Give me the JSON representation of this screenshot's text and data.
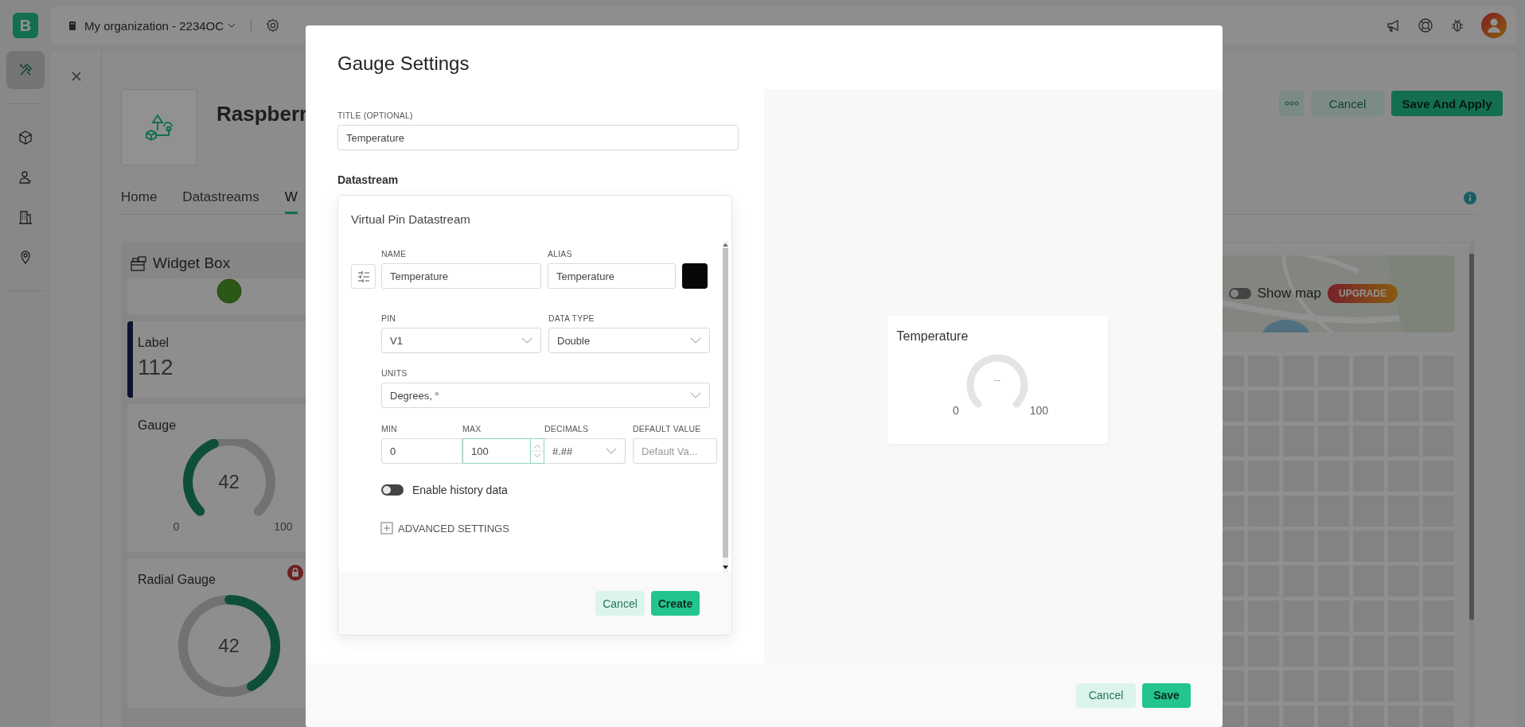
{
  "app": {
    "logo": "B",
    "sidebar": {
      "items": [
        {
          "selected": true
        },
        {
          "selected": false
        },
        {
          "selected": false
        },
        {
          "selected": false
        },
        {
          "selected": false
        }
      ]
    },
    "top_bar": {
      "organization": "My organization - 2234OC"
    },
    "template": {
      "title": "Raspberr",
      "tabs": [
        {
          "label": "Home",
          "selected": false
        },
        {
          "label": "Datastreams",
          "selected": false
        },
        {
          "label": "W",
          "selected": true
        }
      ]
    },
    "actions": {
      "cancel": "Cancel",
      "save": "Save And Apply"
    },
    "widget_box": {
      "title": "Widget Box",
      "widgets": [
        {
          "kind": "led"
        },
        {
          "kind": "label",
          "title": "Label",
          "value": "112"
        },
        {
          "kind": "gauge",
          "title": "Gauge",
          "value": "42",
          "min": "0",
          "max": "100"
        },
        {
          "kind": "radial",
          "title": "Radial Gauge",
          "value": "42"
        }
      ]
    },
    "map": {
      "kind": "picture",
      "toggle_label": "Show map",
      "on": false,
      "badge": "UPGRADE"
    }
  },
  "dialog": {
    "title": "Gauge Settings",
    "title_field": {
      "label": "TITLE (OPTIONAL)",
      "value": "Temperature"
    },
    "datastream": {
      "heading": "Datastream",
      "card_title": "Virtual Pin Datastream",
      "name": {
        "label": "NAME",
        "value": "Temperature"
      },
      "alias": {
        "label": "ALIAS",
        "value": "Temperature"
      },
      "color": "#070707",
      "pin": {
        "label": "PIN",
        "value": "V1"
      },
      "data_type": {
        "label": "DATA TYPE",
        "value": "Double"
      },
      "units": {
        "label": "UNITS",
        "value": "Degrees, °"
      },
      "min": {
        "label": "MIN",
        "value": "0"
      },
      "max": {
        "label": "MAX",
        "value": "100",
        "focused": true
      },
      "decimals": {
        "label": "DECIMALS",
        "value": "#.##"
      },
      "default_value": {
        "label": "DEFAULT VALUE",
        "placeholder": "Default Va..."
      },
      "history": {
        "label": "Enable history data",
        "on": false
      },
      "advanced": {
        "label": "ADVANCED SETTINGS",
        "expanded": false
      },
      "buttons": {
        "cancel": "Cancel",
        "create": "Create"
      }
    },
    "preview": {
      "title": "Temperature",
      "value": "--",
      "min": "0",
      "max": "100"
    },
    "buttons": {
      "cancel": "Cancel",
      "save": "Save"
    }
  }
}
